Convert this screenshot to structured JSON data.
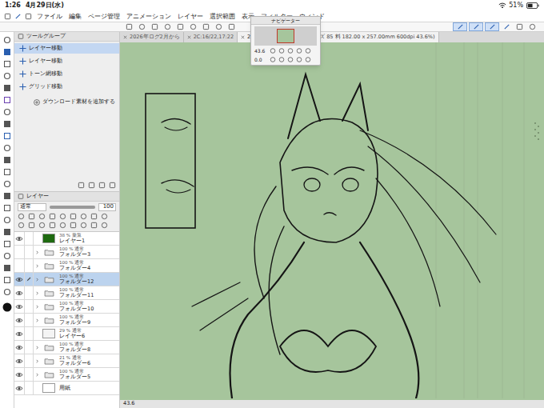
{
  "status_bar": {
    "time": "1:26",
    "date": "4月29日(水)",
    "battery": "51%"
  },
  "menu": [
    "ファイル",
    "編集",
    "ページ管理",
    "アニメーション",
    "レイヤー",
    "選択範囲",
    "表示",
    "フィルター",
    "ウィンド"
  ],
  "tabs": [
    {
      "label": "2026年ログ2月から",
      "selected": false
    },
    {
      "label": "2C:16/22,17:22",
      "selected": false
    },
    {
      "label": "2026年ログ2月から 12",
      "selected": true
    }
  ],
  "doc_info": "サイズ 85 料 182.00 x 257.00mm 600dpi 43.6%)",
  "tool_panel": {
    "title": "ツールグループ",
    "items": [
      {
        "label": "レイヤー移動",
        "selected": true
      },
      {
        "label": "レイヤー移動",
        "selected": false
      },
      {
        "label": "トーン網移動",
        "selected": false
      },
      {
        "label": "グリッド移動",
        "selected": false
      }
    ],
    "add_label": "ダウンロード素材を追加する"
  },
  "layer_panel": {
    "title": "レイヤー",
    "blend": "通常",
    "opacity": "100",
    "layers": [
      {
        "opacity": "38 %",
        "blend": "乗算",
        "name": "レイヤー1",
        "kind": "layer",
        "color": "#1e6a10",
        "visible": true,
        "selected": false
      },
      {
        "opacity": "100 %",
        "blend": "通常",
        "name": "フォルダー3",
        "kind": "folder",
        "color": "#ffffff",
        "visible": false,
        "selected": false
      },
      {
        "opacity": "100 %",
        "blend": "通常",
        "name": "フォルダー4",
        "kind": "folder",
        "color": "#ffffff",
        "visible": false,
        "selected": false
      },
      {
        "opacity": "100 %",
        "blend": "通常",
        "name": "フォルダー12",
        "kind": "folder",
        "color": "#ffffff",
        "visible": true,
        "selected": true
      },
      {
        "opacity": "100 %",
        "blend": "通常",
        "name": "フォルダー11",
        "kind": "folder",
        "color": "#ffffff",
        "visible": true,
        "selected": false
      },
      {
        "opacity": "100 %",
        "blend": "通常",
        "name": "フォルダー10",
        "kind": "folder",
        "color": "#ffffff",
        "visible": true,
        "selected": false
      },
      {
        "opacity": "100 %",
        "blend": "通常",
        "name": "フォルダー9",
        "kind": "folder",
        "color": "#ffffff",
        "visible": true,
        "selected": false
      },
      {
        "opacity": "29 %",
        "blend": "通常",
        "name": "レイヤー6",
        "kind": "layer",
        "color": "#f4f4f4",
        "visible": true,
        "selected": false
      },
      {
        "opacity": "100 %",
        "blend": "通常",
        "name": "フォルダー8",
        "kind": "folder",
        "color": "#ffffff",
        "visible": true,
        "selected": false
      },
      {
        "opacity": "21 %",
        "blend": "通常",
        "name": "フォルダー6",
        "kind": "folder",
        "color": "#ffffff",
        "visible": true,
        "selected": false
      },
      {
        "opacity": "100 %",
        "blend": "通常",
        "name": "フォルダー5",
        "kind": "folder",
        "color": "#ffffff",
        "visible": true,
        "selected": false
      },
      {
        "opacity": "",
        "blend": "",
        "name": "用紙",
        "kind": "paper",
        "color": "#ffffff",
        "visible": true,
        "selected": false
      }
    ]
  },
  "navigator": {
    "title": "ナビゲーター",
    "zoom": "43.6",
    "angle": "0.0"
  },
  "footer": {
    "zoom": "43.6"
  }
}
